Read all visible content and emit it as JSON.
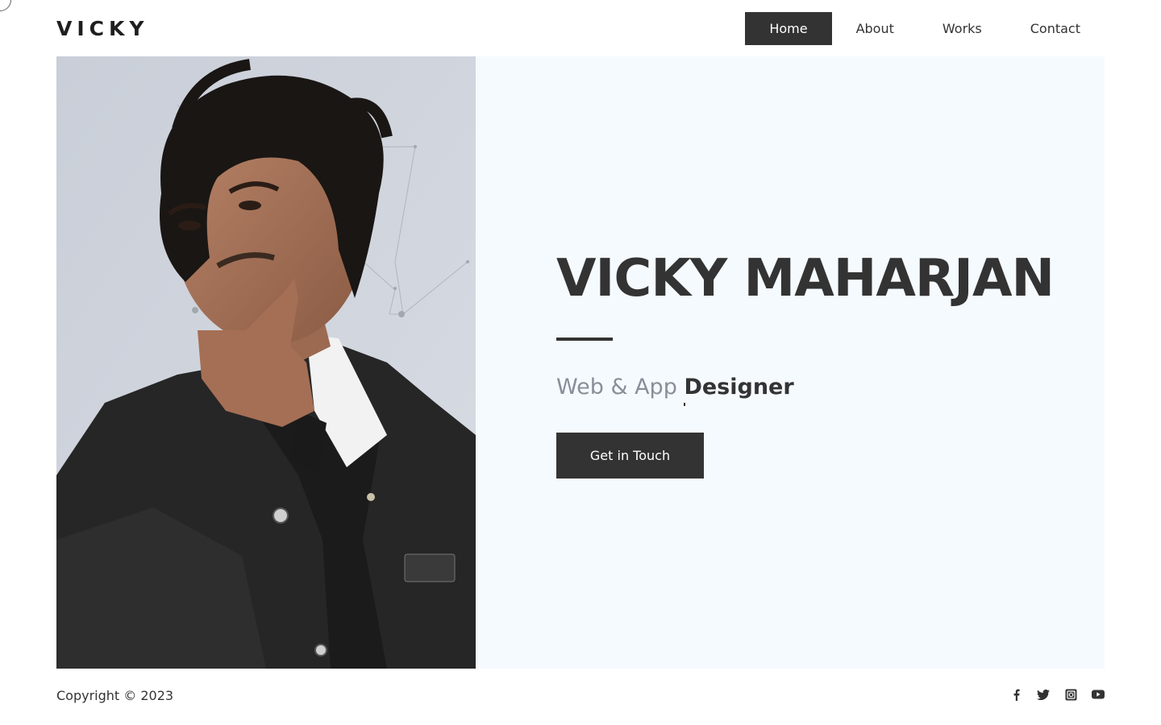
{
  "brand": {
    "logo_text": "VICKY"
  },
  "nav": {
    "items": [
      {
        "label": "Home",
        "active": true
      },
      {
        "label": "About",
        "active": false
      },
      {
        "label": "Works",
        "active": false
      },
      {
        "label": "Contact",
        "active": false
      }
    ]
  },
  "hero": {
    "name": "VICKY MAHARJAN",
    "role_prefix": "Web & App",
    "role_word": "Designer",
    "cta_label": "Get in Touch"
  },
  "footer": {
    "copyright": "Copyright © 2023",
    "socials": [
      "facebook-icon",
      "twitter-icon",
      "instagram-icon",
      "youtube-icon"
    ]
  },
  "colors": {
    "dark": "#333333",
    "hero_bg": "#f5faff",
    "muted_text": "#8a8e98",
    "white": "#ffffff"
  }
}
